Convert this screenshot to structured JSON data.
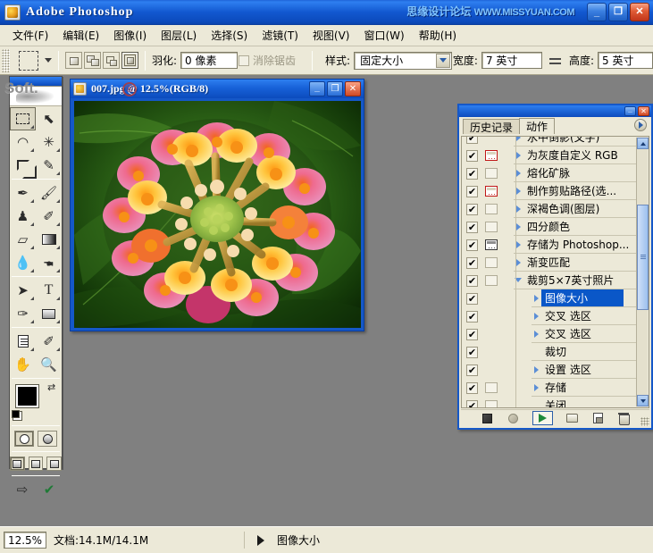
{
  "window": {
    "app_title": "Adobe Photoshop",
    "watermark": "思缘设计论坛",
    "watermark_domain": "WWW.MISSYUAN.COM",
    "minimize_glyph": "_",
    "maximize_glyph": "❐",
    "close_glyph": "✕"
  },
  "menu": [
    {
      "label": "文件(F)"
    },
    {
      "label": "编辑(E)"
    },
    {
      "label": "图像(I)"
    },
    {
      "label": "图层(L)"
    },
    {
      "label": "选择(S)"
    },
    {
      "label": "滤镜(T)"
    },
    {
      "label": "视图(V)"
    },
    {
      "label": "窗口(W)"
    },
    {
      "label": "帮助(H)"
    }
  ],
  "options_bar": {
    "tool_icon": "rectangular-marquee-icon",
    "selection_modes": [
      "new-selection",
      "add-to-selection",
      "subtract-from-selection",
      "intersect-with-selection"
    ],
    "selection_mode_active": 3,
    "feather_label": "羽化:",
    "feather_value": "0 像素",
    "antialias_label": "消除锯齿",
    "antialias_checked": false,
    "style_label": "样式:",
    "style_value": "固定大小",
    "width_label": "宽度:",
    "width_value": "7 英寸",
    "height_label": "高度:",
    "height_value": "5 英寸",
    "swap_icon": "swap-dimensions-icon"
  },
  "toolbox": {
    "tools": [
      {
        "name": "rectangular-marquee-tool",
        "glyph": "",
        "kind": "marquee",
        "selected": true,
        "menu": true
      },
      {
        "name": "move-tool",
        "glyph": "✛",
        "kind": "move",
        "selected": false,
        "menu": false
      },
      {
        "name": "lasso-tool",
        "glyph": "◯",
        "kind": "lasso",
        "selected": false,
        "menu": true
      },
      {
        "name": "magic-wand-tool",
        "glyph": "✳",
        "kind": "wand",
        "selected": false,
        "menu": false
      },
      {
        "name": "crop-tool",
        "glyph": "",
        "kind": "crop",
        "selected": false,
        "menu": false
      },
      {
        "name": "slice-tool",
        "glyph": "✂",
        "kind": "slice",
        "selected": false,
        "menu": true
      },
      {
        "name": "healing-brush-tool",
        "glyph": "✒",
        "kind": "heal",
        "selected": false,
        "menu": true
      },
      {
        "name": "brush-tool",
        "glyph": "✎",
        "kind": "brush",
        "selected": false,
        "menu": true
      },
      {
        "name": "clone-stamp-tool",
        "glyph": "♜",
        "kind": "stamp",
        "selected": false,
        "menu": true
      },
      {
        "name": "history-brush-tool",
        "glyph": "✐",
        "kind": "histbr",
        "selected": false,
        "menu": true
      },
      {
        "name": "eraser-tool",
        "glyph": "▱",
        "kind": "eraser",
        "selected": false,
        "menu": true
      },
      {
        "name": "gradient-tool",
        "glyph": "",
        "kind": "grad",
        "selected": false,
        "menu": true
      },
      {
        "name": "blur-tool",
        "glyph": "💧",
        "kind": "blur",
        "selected": false,
        "menu": true
      },
      {
        "name": "dodge-tool",
        "glyph": "●",
        "kind": "dodge",
        "selected": false,
        "menu": true
      },
      {
        "name": "path-selection-tool",
        "glyph": "➤",
        "kind": "pathsel",
        "selected": false,
        "menu": true
      },
      {
        "name": "type-tool",
        "glyph": "T",
        "kind": "type",
        "selected": false,
        "menu": true
      },
      {
        "name": "pen-tool",
        "glyph": "✑",
        "kind": "pen",
        "selected": false,
        "menu": true
      },
      {
        "name": "shape-tool",
        "glyph": "",
        "kind": "shape",
        "selected": false,
        "menu": true
      },
      {
        "name": "notes-tool",
        "glyph": "",
        "kind": "note",
        "selected": false,
        "menu": true
      },
      {
        "name": "eyedropper-tool",
        "glyph": "✐",
        "kind": "eyedrop",
        "selected": false,
        "menu": true
      },
      {
        "name": "hand-tool",
        "glyph": "✋",
        "kind": "hand",
        "selected": false,
        "menu": false
      },
      {
        "name": "zoom-tool",
        "glyph": "🔍",
        "kind": "zoom",
        "selected": false,
        "menu": false
      }
    ],
    "foreground_color": "#000000",
    "background_color": "#ffffff",
    "swap_colors_icon": "swap-colors-icon",
    "default_colors_icon": "default-colors-icon",
    "mask_modes": [
      "standard-mask-mode",
      "quick-mask-mode"
    ],
    "mask_mode_active": 0,
    "screen_modes": [
      "standard-screen-mode",
      "full-screen-with-menubar",
      "full-screen-mode"
    ],
    "screen_mode_active": 0,
    "jump_to_imageready_icon": "jump-to-imageready-icon"
  },
  "document": {
    "title": "007.jpg @ 12.5%(RGB/8)",
    "watermark": "Soft.",
    "watermark_badge": "®",
    "minimize_glyph": "_",
    "maximize_glyph": "❐",
    "close_glyph": "✕",
    "image_alt": "lantana-flower-photo"
  },
  "palette": {
    "tabs": [
      {
        "label": "历史记录",
        "name": "tab-history",
        "active": false
      },
      {
        "label": "动作",
        "name": "tab-actions",
        "active": true
      }
    ],
    "menu_icon": "palette-menu-icon",
    "minimize_glyph": "_",
    "close_glyph": "✕",
    "actions": [
      {
        "label": "水中倒影(文字)",
        "checked": true,
        "dialog": "none",
        "expandable": true,
        "indent": false,
        "selected": false,
        "partial": true
      },
      {
        "label": "为灰度自定义 RGB",
        "checked": true,
        "dialog": "red",
        "expandable": true,
        "indent": false,
        "selected": false
      },
      {
        "label": "熔化矿脉",
        "checked": true,
        "dialog": "empty",
        "expandable": true,
        "indent": false,
        "selected": false
      },
      {
        "label": "制作剪贴路径(选...",
        "checked": true,
        "dialog": "red",
        "expandable": true,
        "indent": false,
        "selected": false
      },
      {
        "label": "深褐色调(图层)",
        "checked": true,
        "dialog": "empty",
        "expandable": true,
        "indent": false,
        "selected": false
      },
      {
        "label": "四分颜色",
        "checked": true,
        "dialog": "empty",
        "expandable": true,
        "indent": false,
        "selected": false
      },
      {
        "label": "存储为 Photoshop...",
        "checked": true,
        "dialog": "gray",
        "expandable": true,
        "indent": false,
        "selected": false
      },
      {
        "label": "渐变匹配",
        "checked": true,
        "dialog": "empty",
        "expandable": true,
        "indent": false,
        "selected": false
      },
      {
        "label": "裁剪5×7英寸照片",
        "checked": true,
        "dialog": "empty",
        "expandable": true,
        "indent": false,
        "selected": false,
        "open": true
      },
      {
        "label": "图像大小",
        "checked": true,
        "dialog": "none",
        "expandable": true,
        "indent": true,
        "selected": true
      },
      {
        "label": "交叉 选区",
        "checked": true,
        "dialog": "none",
        "expandable": true,
        "indent": true,
        "selected": false
      },
      {
        "label": "交叉 选区",
        "checked": true,
        "dialog": "none",
        "expandable": true,
        "indent": true,
        "selected": false
      },
      {
        "label": "裁切",
        "checked": true,
        "dialog": "none",
        "expandable": false,
        "indent": true,
        "selected": false
      },
      {
        "label": "设置 选区",
        "checked": true,
        "dialog": "none",
        "expandable": true,
        "indent": true,
        "selected": false
      },
      {
        "label": "存储",
        "checked": true,
        "dialog": "empty",
        "expandable": true,
        "indent": true,
        "selected": false
      },
      {
        "label": "关闭",
        "checked": true,
        "dialog": "empty",
        "expandable": false,
        "indent": true,
        "selected": false
      }
    ],
    "toolbar": [
      {
        "name": "stop-playing-button",
        "icon": "stop-icon"
      },
      {
        "name": "begin-recording-button",
        "icon": "record-icon"
      },
      {
        "name": "play-selection-button",
        "icon": "play-icon"
      },
      {
        "name": "create-new-set-button",
        "icon": "folder-icon"
      },
      {
        "name": "create-new-action-button",
        "icon": "new-action-icon"
      },
      {
        "name": "delete-button",
        "icon": "trash-icon"
      }
    ]
  },
  "status_bar": {
    "zoom": "12.5%",
    "doc_info": "文档:14.1M/14.1M",
    "arrow_icon": "status-menu-arrow-icon",
    "extra_info": "图像大小"
  }
}
